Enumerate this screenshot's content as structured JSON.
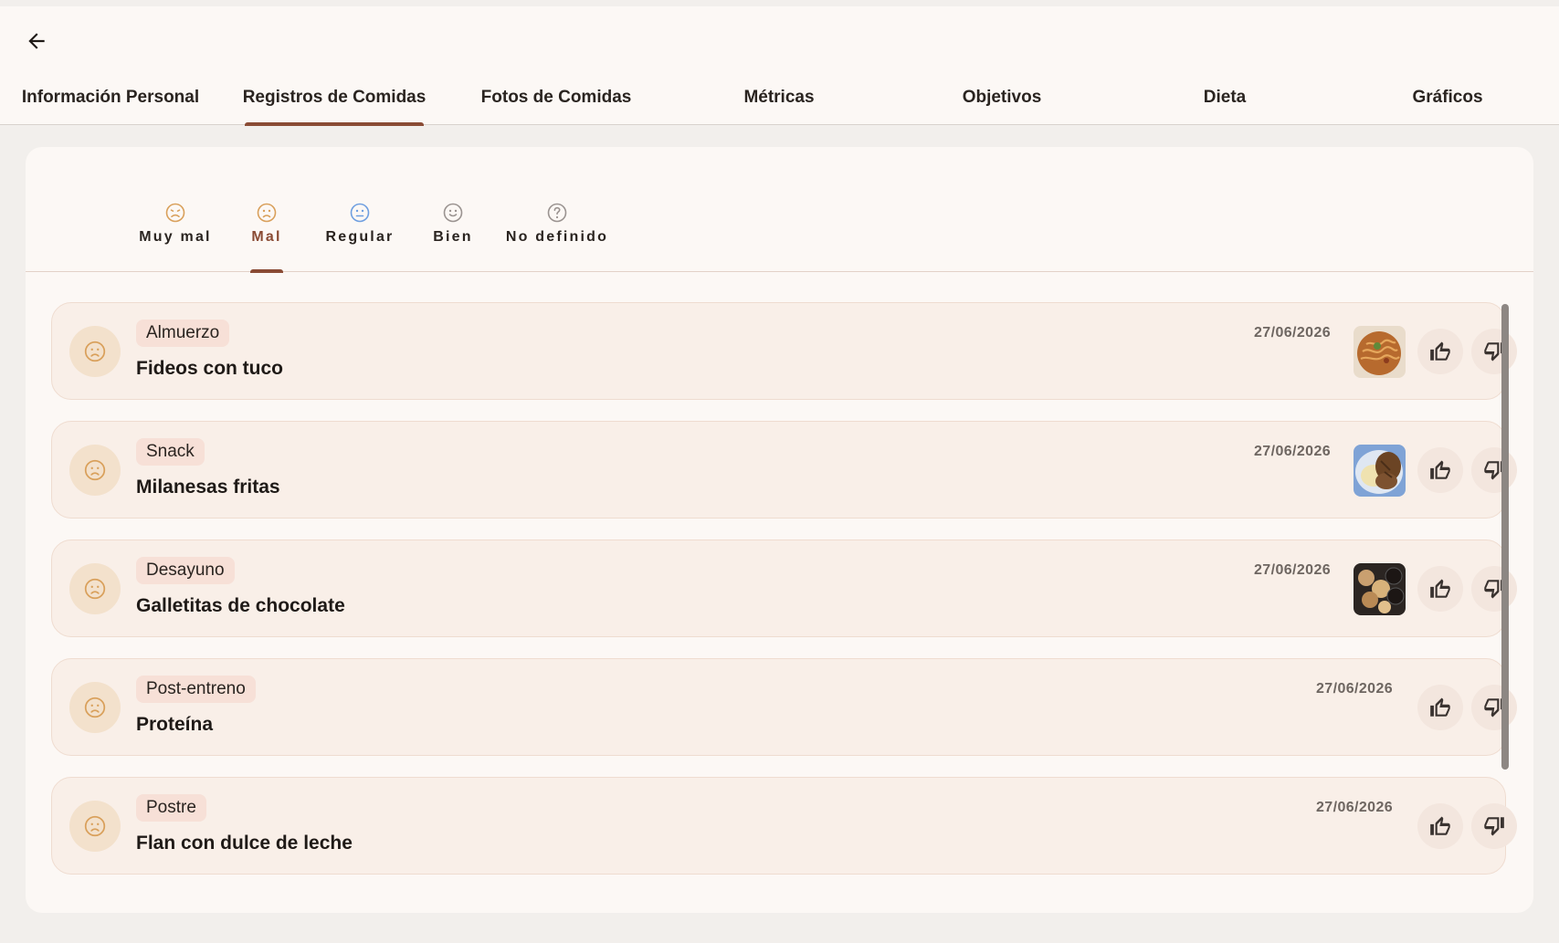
{
  "tabs": [
    {
      "label": "Información Personal"
    },
    {
      "label": "Registros de Comidas"
    },
    {
      "label": "Fotos de Comidas"
    },
    {
      "label": "Métricas"
    },
    {
      "label": "Objetivos"
    },
    {
      "label": "Dieta"
    },
    {
      "label": "Gráficos"
    }
  ],
  "active_tab": "Registros de Comidas",
  "filters": [
    {
      "label": "Muy mal",
      "icon": "very-sad-face-icon",
      "color": "#d9a05b"
    },
    {
      "label": "Mal",
      "icon": "sad-face-icon",
      "color": "#d9a05b"
    },
    {
      "label": "Regular",
      "icon": "neutral-face-icon",
      "color": "#6f9fe0"
    },
    {
      "label": "Bien",
      "icon": "happy-face-icon",
      "color": "#9a9390"
    },
    {
      "label": "No definido",
      "icon": "question-icon",
      "color": "#9a9390"
    }
  ],
  "active_filter": "Mal",
  "meals": [
    {
      "type": "Almuerzo",
      "name": "Fideos con tuco",
      "date": "27/06/2026",
      "has_photo": true
    },
    {
      "type": "Snack",
      "name": "Milanesas fritas",
      "date": "27/06/2026",
      "has_photo": true
    },
    {
      "type": "Desayuno",
      "name": "Galletitas de chocolate",
      "date": "27/06/2026",
      "has_photo": true
    },
    {
      "type": "Post-entreno",
      "name": "Proteína",
      "date": "27/06/2026",
      "has_photo": false
    },
    {
      "type": "Postre",
      "name": "Flan con dulce de leche",
      "date": "27/06/2026",
      "has_photo": false
    }
  ],
  "colors": {
    "accent": "#8a4b34",
    "mood_icon": "#d9a05b",
    "card_bg": "#f9efe8",
    "chip_bg": "#f7e0d7"
  }
}
